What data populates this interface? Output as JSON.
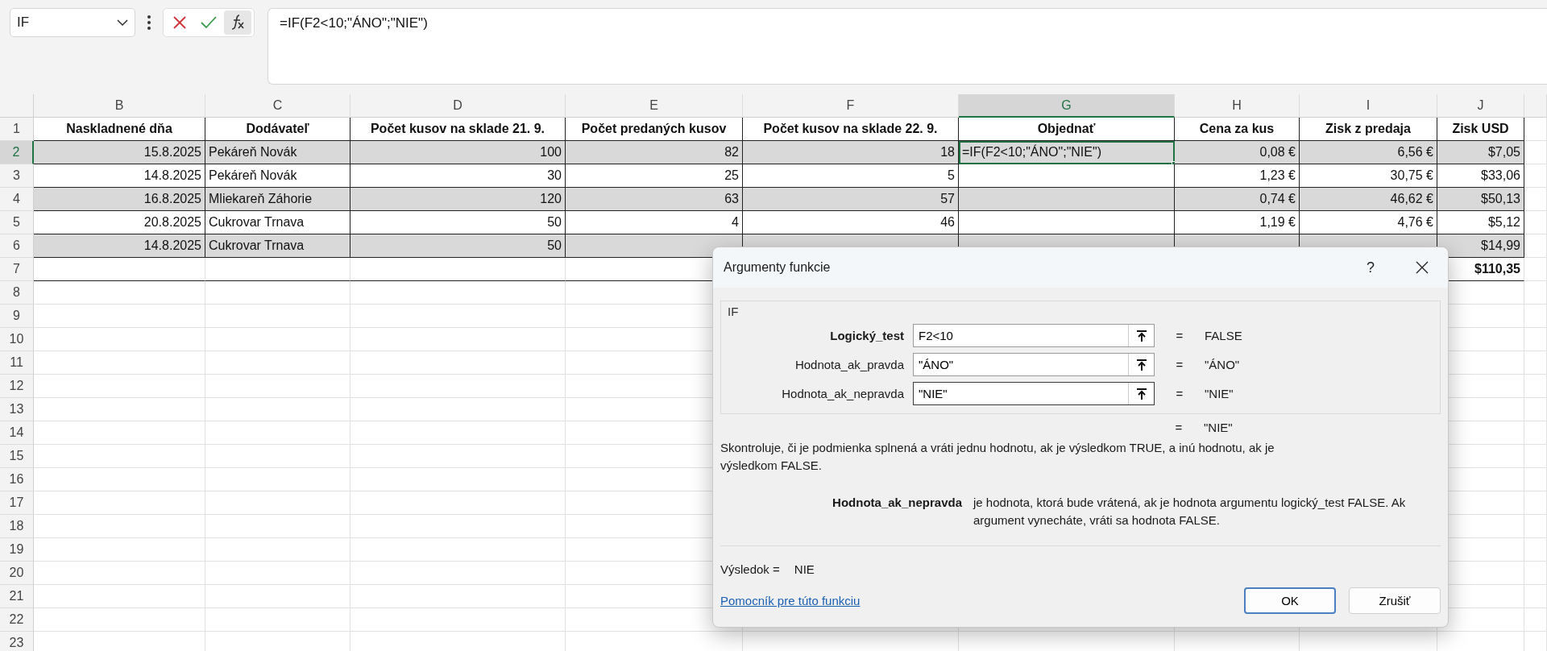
{
  "formula_bar": {
    "name_box": "IF",
    "formula": "=IF(F2<10;\"ÁNO\";\"NIE\")"
  },
  "columns": [
    {
      "label": "B",
      "selected": false
    },
    {
      "label": "C",
      "selected": false
    },
    {
      "label": "D",
      "selected": false
    },
    {
      "label": "E",
      "selected": false
    },
    {
      "label": "F",
      "selected": false
    },
    {
      "label": "G",
      "selected": true
    },
    {
      "label": "H",
      "selected": false
    },
    {
      "label": "I",
      "selected": false
    },
    {
      "label": "J",
      "selected": false
    }
  ],
  "rows": [
    {
      "number": "1",
      "selected": false,
      "kind": "header",
      "cells": [
        {
          "kind": "header",
          "text": "Naskladnené dňa"
        },
        {
          "kind": "header",
          "text": "Dodávateľ"
        },
        {
          "kind": "header",
          "text": "Počet kusov na sklade 21. 9."
        },
        {
          "kind": "header",
          "text": "Počet predaných kusov"
        },
        {
          "kind": "header",
          "text": "Počet kusov na sklade 22. 9."
        },
        {
          "kind": "header",
          "text": "Objednať"
        },
        {
          "kind": "header",
          "text": "Cena za kus"
        },
        {
          "kind": "header",
          "text": "Zisk z predaja"
        },
        {
          "kind": "header",
          "text": "Zisk USD"
        }
      ]
    },
    {
      "number": "2",
      "selected": true,
      "kind": "data",
      "shaded": true,
      "cells": [
        {
          "kind": "number",
          "text": "15.8.2025"
        },
        {
          "kind": "text",
          "text": "Pekáreň Novák"
        },
        {
          "kind": "number",
          "text": "100"
        },
        {
          "kind": "number",
          "text": "82"
        },
        {
          "kind": "number",
          "text": "18"
        },
        {
          "kind": "text",
          "text": "=IF(F2<10;\"ÁNO\";\"NIE\")"
        },
        {
          "kind": "number",
          "text": "0,08 €"
        },
        {
          "kind": "number",
          "text": "6,56 €"
        },
        {
          "kind": "number",
          "text": "$7,05"
        }
      ]
    },
    {
      "number": "3",
      "selected": false,
      "kind": "data",
      "shaded": false,
      "cells": [
        {
          "kind": "number",
          "text": "14.8.2025"
        },
        {
          "kind": "text",
          "text": "Pekáreň Novák"
        },
        {
          "kind": "number",
          "text": "30"
        },
        {
          "kind": "number",
          "text": "25"
        },
        {
          "kind": "number",
          "text": "5"
        },
        {
          "kind": "empty"
        },
        {
          "kind": "number",
          "text": "1,23 €"
        },
        {
          "kind": "number",
          "text": "30,75 €"
        },
        {
          "kind": "number",
          "text": "$33,06"
        }
      ]
    },
    {
      "number": "4",
      "selected": false,
      "kind": "data",
      "shaded": true,
      "cells": [
        {
          "kind": "number",
          "text": "16.8.2025"
        },
        {
          "kind": "text",
          "text": "Mliekareň Záhorie"
        },
        {
          "kind": "number",
          "text": "120"
        },
        {
          "kind": "number",
          "text": "63"
        },
        {
          "kind": "number",
          "text": "57"
        },
        {
          "kind": "empty"
        },
        {
          "kind": "number",
          "text": "0,74 €"
        },
        {
          "kind": "number",
          "text": "46,62 €"
        },
        {
          "kind": "number",
          "text": "$50,13"
        }
      ]
    },
    {
      "number": "5",
      "selected": false,
      "kind": "data",
      "shaded": false,
      "cells": [
        {
          "kind": "number",
          "text": "20.8.2025"
        },
        {
          "kind": "text",
          "text": "Cukrovar Trnava"
        },
        {
          "kind": "number",
          "text": "50"
        },
        {
          "kind": "number",
          "text": "4"
        },
        {
          "kind": "number",
          "text": "46"
        },
        {
          "kind": "empty"
        },
        {
          "kind": "number",
          "text": "1,19 €"
        },
        {
          "kind": "number",
          "text": "4,76 €"
        },
        {
          "kind": "number",
          "text": "$5,12"
        }
      ]
    },
    {
      "number": "6",
      "selected": false,
      "kind": "data",
      "shaded": true,
      "cells": [
        {
          "kind": "number",
          "text": "14.8.2025"
        },
        {
          "kind": "text",
          "text": "Cukrovar Trnava"
        },
        {
          "kind": "number",
          "text": "50"
        },
        {
          "kind": "empty"
        },
        {
          "kind": "empty"
        },
        {
          "kind": "empty"
        },
        {
          "kind": "empty"
        },
        {
          "kind": "empty"
        },
        {
          "kind": "number",
          "text": "$14,99"
        }
      ]
    },
    {
      "number": "7",
      "selected": false,
      "kind": "total",
      "cells": [
        {
          "kind": "empty"
        },
        {
          "kind": "empty"
        },
        {
          "kind": "empty"
        },
        {
          "kind": "empty"
        },
        {
          "kind": "covered"
        },
        {
          "kind": "covered"
        },
        {
          "kind": "covered"
        },
        {
          "kind": "covered"
        },
        {
          "kind": "total",
          "text": "$110,35"
        }
      ]
    },
    {
      "number": "8",
      "selected": false,
      "kind": "empty"
    },
    {
      "number": "9",
      "selected": false,
      "kind": "empty"
    },
    {
      "number": "10",
      "selected": false,
      "kind": "empty"
    },
    {
      "number": "11",
      "selected": false,
      "kind": "empty"
    },
    {
      "number": "12",
      "selected": false,
      "kind": "empty"
    },
    {
      "number": "13",
      "selected": false,
      "kind": "empty"
    },
    {
      "number": "14",
      "selected": false,
      "kind": "empty"
    },
    {
      "number": "15",
      "selected": false,
      "kind": "empty"
    },
    {
      "number": "16",
      "selected": false,
      "kind": "empty"
    },
    {
      "number": "17",
      "selected": false,
      "kind": "empty"
    },
    {
      "number": "18",
      "selected": false,
      "kind": "empty"
    },
    {
      "number": "19",
      "selected": false,
      "kind": "empty"
    },
    {
      "number": "20",
      "selected": false,
      "kind": "empty"
    },
    {
      "number": "21",
      "selected": false,
      "kind": "empty"
    },
    {
      "number": "22",
      "selected": false,
      "kind": "empty"
    },
    {
      "number": "23",
      "selected": false,
      "kind": "empty"
    }
  ],
  "dialog": {
    "title": "Argumenty funkcie",
    "help": "?",
    "function_name": "IF",
    "arguments": [
      {
        "label": "Logický_test",
        "required": true,
        "value": "F2<10",
        "equals": "=",
        "result": "FALSE",
        "focused": false
      },
      {
        "label": "Hodnota_ak_pravda",
        "required": false,
        "value": "\"ÁNO\"",
        "equals": "=",
        "result": "\"ÁNO\"",
        "focused": false
      },
      {
        "label": "Hodnota_ak_nepravda",
        "required": false,
        "value": "\"NIE\"",
        "equals": "=",
        "result": "\"NIE\"",
        "focused": true
      }
    ],
    "formula_equals": "=",
    "formula_result": "\"NIE\"",
    "description": "Skontroluje, či je podmienka splnená a vráti jednu hodnotu, ak je výsledkom TRUE, a inú hodnotu, ak je výsledkom FALSE.",
    "argument_help": {
      "name": "Hodnota_ak_nepravda",
      "text": "je hodnota, ktorá bude vrátená, ak je hodnota argumentu logický_test FALSE. Ak argument vynecháte, vráti sa hodnota FALSE."
    },
    "result_label": "Výsledok =",
    "result_value": "NIE",
    "help_link": "Pomocník pre túto funkciu",
    "buttons": [
      {
        "label": "OK",
        "default": true
      },
      {
        "label": "Zrušiť",
        "default": false
      }
    ]
  }
}
